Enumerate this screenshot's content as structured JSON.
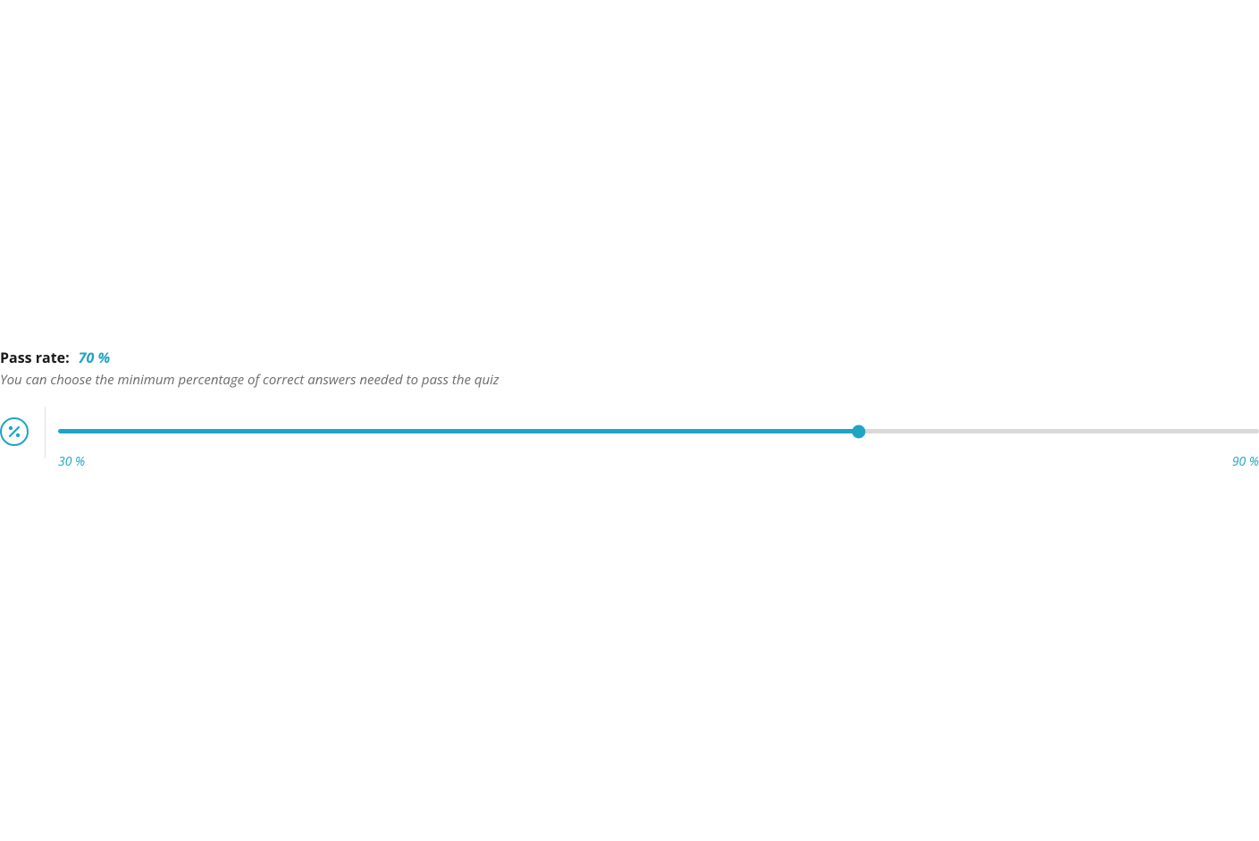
{
  "passRate": {
    "label": "Pass rate:",
    "value": "70 %",
    "description": "You can choose the minimum percentage of correct answers needed to pass the quiz",
    "slider": {
      "min": 30,
      "max": 90,
      "current": 70,
      "minLabel": "30 %",
      "maxLabel": "90 %",
      "fillPercent": 66.67,
      "thumbPercent": 66.67
    },
    "iconName": "percent-icon"
  },
  "colors": {
    "accent": "#1fa5c4",
    "trackEmpty": "#d9d9d9",
    "textMuted": "#6b6b6b"
  }
}
